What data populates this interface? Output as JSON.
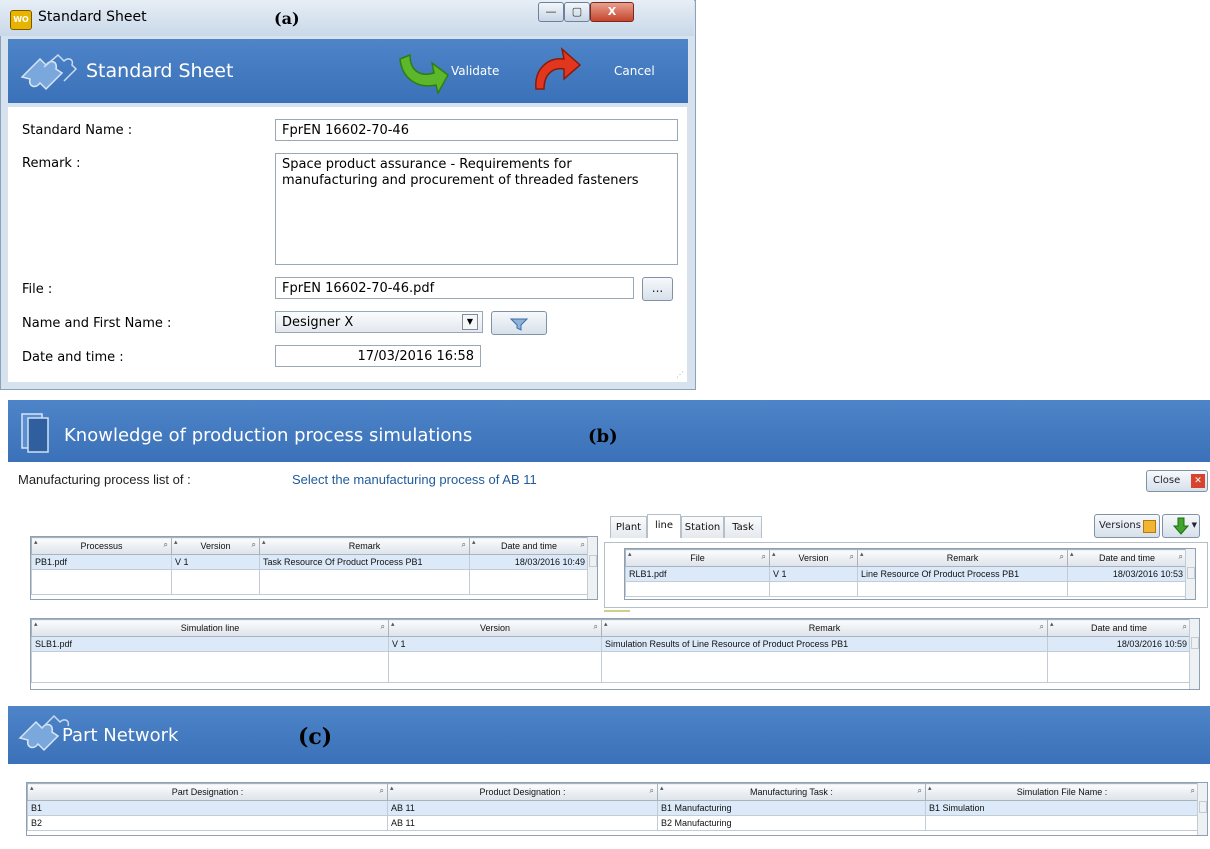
{
  "panel_a": {
    "label": "(a)",
    "window_title": "Standard Sheet",
    "app_icon_text": "WO",
    "minimize_glyph": "—",
    "maximize_glyph": "▢",
    "close_glyph": "X",
    "heading": "Standard Sheet",
    "toolbar": {
      "validate_label": "Validate",
      "cancel_label": "Cancel"
    },
    "form": {
      "standard_name_label": "Standard Name :",
      "standard_name_value": "FprEN 16602-70-46",
      "remark_label": "Remark :",
      "remark_value": "Space product assurance - Requirements for manufacturing and procurement of threaded fasteners",
      "file_label": "File :",
      "file_value": "FprEN 16602-70-46.pdf",
      "browse_label": "...",
      "name_label": "Name and First Name :",
      "name_value": "Designer X",
      "datetime_label": "Date and time :",
      "datetime_value": "17/03/2016 16:58"
    }
  },
  "panel_b": {
    "label": "(b)",
    "heading": "Knowledge of production process simulations",
    "list_label": "Manufacturing process list of :",
    "list_value": "Select the manufacturing process of AB 11",
    "close_label": "Close",
    "close_glyph": "✕",
    "versions_label": "Versions",
    "tabs": [
      "Plant",
      "line",
      "Station",
      "Task"
    ],
    "active_tab": "line",
    "process_grid": {
      "columns": [
        "Processus",
        "Version",
        "Remark",
        "Date and time"
      ],
      "rows": [
        [
          "PB1.pdf",
          "V 1",
          "Task Resource Of Product Process PB1",
          "18/03/2016 10:49"
        ]
      ]
    },
    "line_grid": {
      "columns": [
        "File",
        "Version",
        "Remark",
        "Date and time"
      ],
      "rows": [
        [
          "RLB1.pdf",
          "V 1",
          "Line Resource Of Product Process PB1",
          "18/03/2016 10:53"
        ]
      ]
    },
    "simulation_grid": {
      "columns": [
        "Simulation line",
        "Version",
        "Remark",
        "Date and time"
      ],
      "rows": [
        [
          "SLB1.pdf",
          "V 1",
          "Simulation Results of Line Resource of Product Process PB1",
          "18/03/2016 10:59"
        ]
      ]
    }
  },
  "panel_c": {
    "label": "(c)",
    "heading": "Part Network",
    "grid": {
      "columns": [
        "Part Designation :",
        "Product Designation :",
        "Manufacturing Task :",
        "Simulation File Name :"
      ],
      "rows": [
        [
          "B1",
          "AB 11",
          "B1 Manufacturing",
          "B1 Simulation"
        ],
        [
          "B2",
          "AB 11",
          "B2 Manufacturing",
          ""
        ]
      ]
    }
  },
  "colors": {
    "header_blue": "#3a71b8",
    "selection": "#dce9f8",
    "validate_green": "#5cb82a",
    "cancel_red": "#e2371e"
  }
}
